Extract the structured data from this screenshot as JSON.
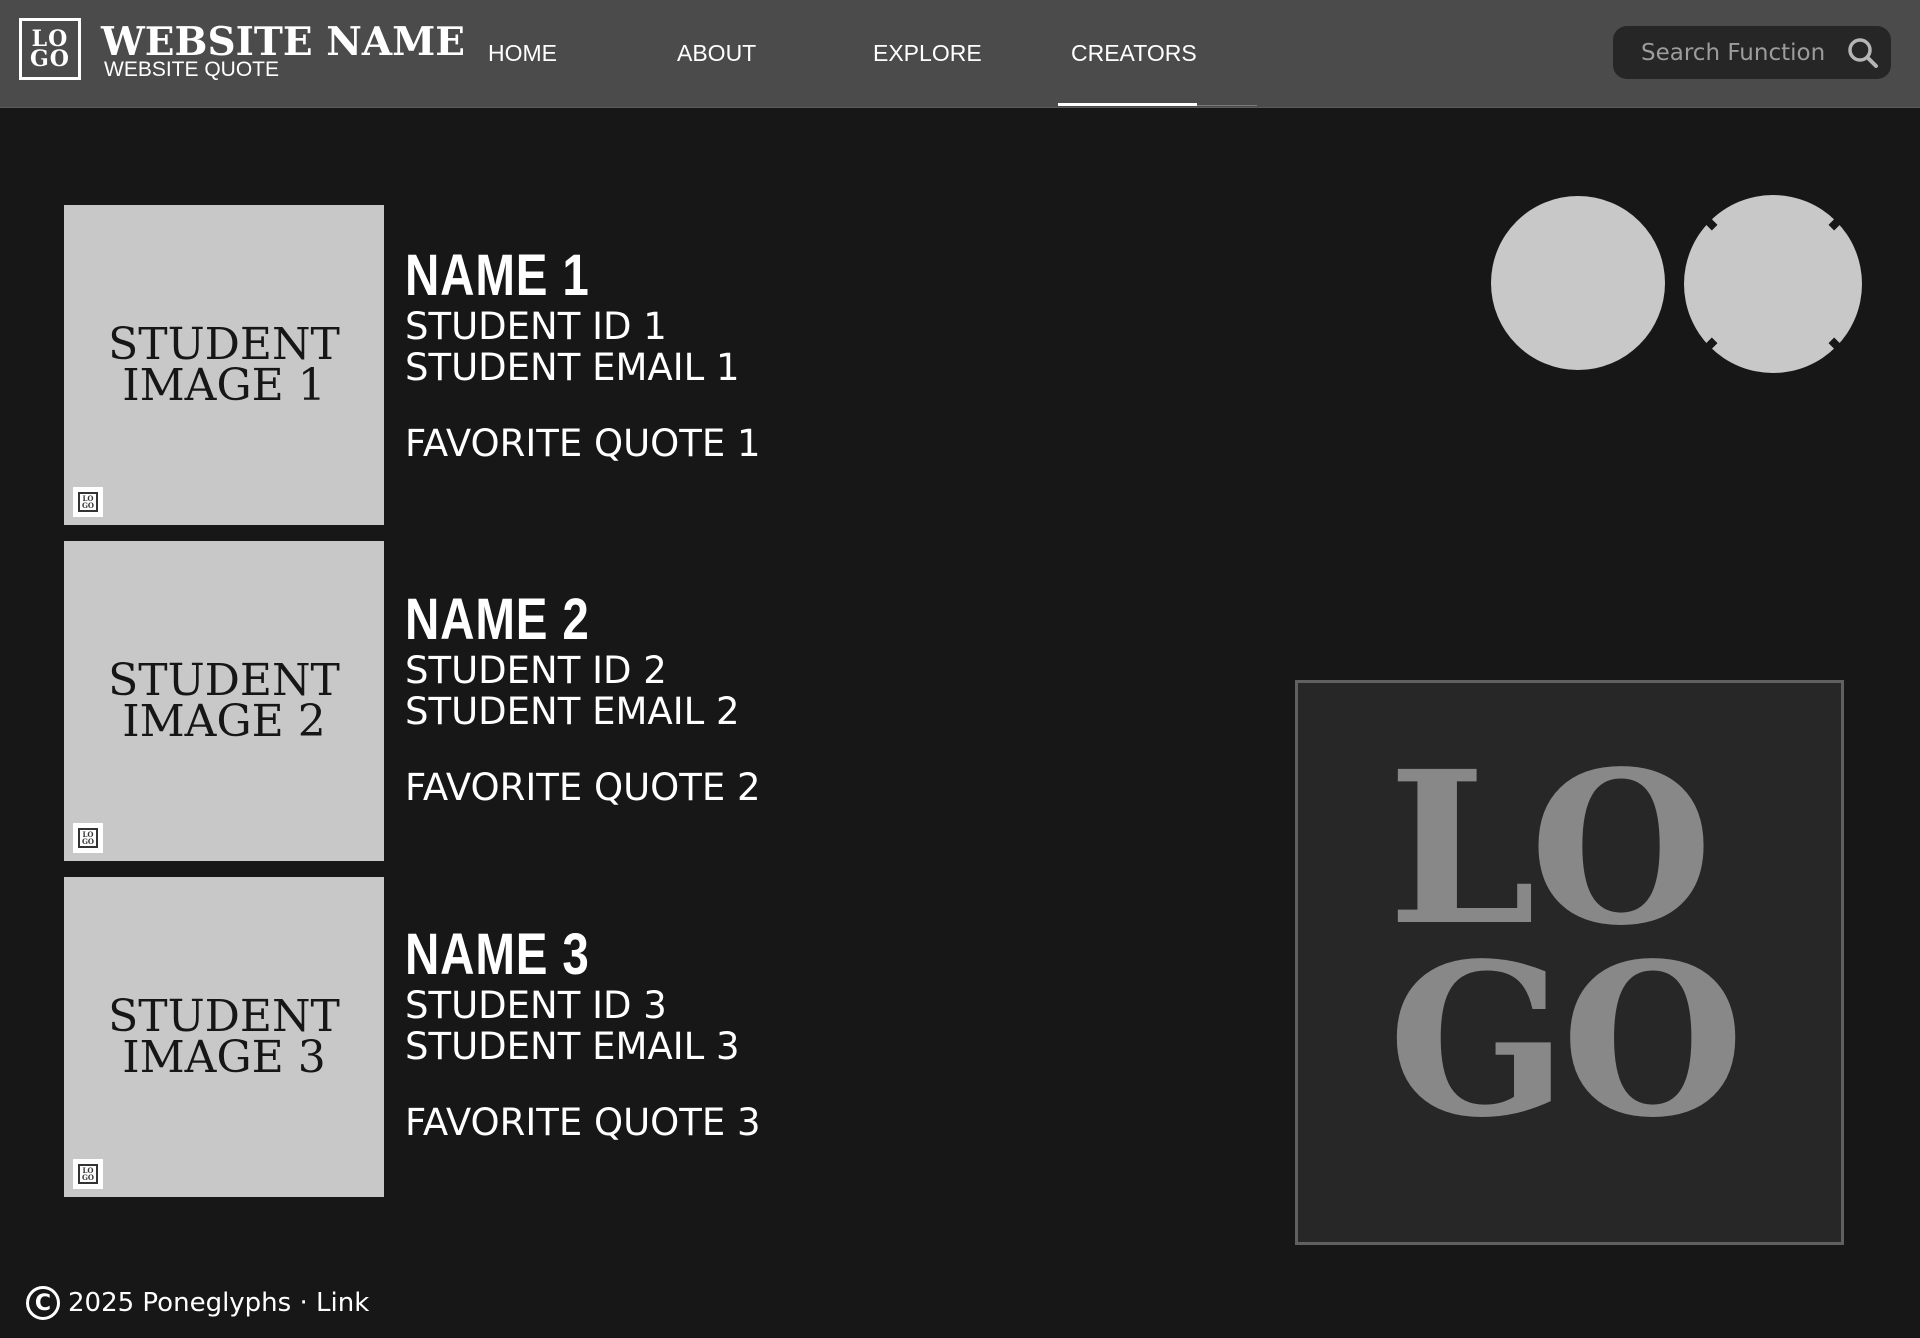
{
  "header": {
    "logo_line1": "LO",
    "logo_line2": "GO",
    "site_name": "WEBSITE NAME",
    "site_quote": "WEBSITE QUOTE",
    "nav": [
      {
        "label": "HOME"
      },
      {
        "label": "ABOUT"
      },
      {
        "label": "EXPLORE"
      },
      {
        "label": "CREATORS",
        "active": true
      }
    ],
    "search": {
      "placeholder": "Search Function",
      "icon": "search-icon"
    }
  },
  "students": [
    {
      "image_line1": "STUDENT",
      "image_line2": "IMAGE 1",
      "name": "NAME 1",
      "id": "STUDENT ID 1",
      "email": "STUDENT EMAIL 1",
      "quote": "FAVORITE QUOTE 1"
    },
    {
      "image_line1": "STUDENT",
      "image_line2": "IMAGE 2",
      "name": "NAME 2",
      "id": "STUDENT ID 2",
      "email": "STUDENT EMAIL 2",
      "quote": "FAVORITE QUOTE 2"
    },
    {
      "image_line1": "STUDENT",
      "image_line2": "IMAGE 3",
      "name": "NAME 3",
      "id": "STUDENT ID 3",
      "email": "STUDENT EMAIL 3",
      "quote": "FAVORITE QUOTE 3"
    }
  ],
  "mini_logo": {
    "line1": "LO",
    "line2": "GO"
  },
  "big_logo": {
    "line1": "LO",
    "line2": "GO"
  },
  "footer": {
    "copyright_symbol": "C",
    "text": "2025 Poneglyphs · ",
    "link": "Link"
  },
  "colors": {
    "background": "#171717",
    "header": "#4b4b4b",
    "placeholder_gray": "#c8c8c8",
    "logo_gray": "#888888"
  }
}
